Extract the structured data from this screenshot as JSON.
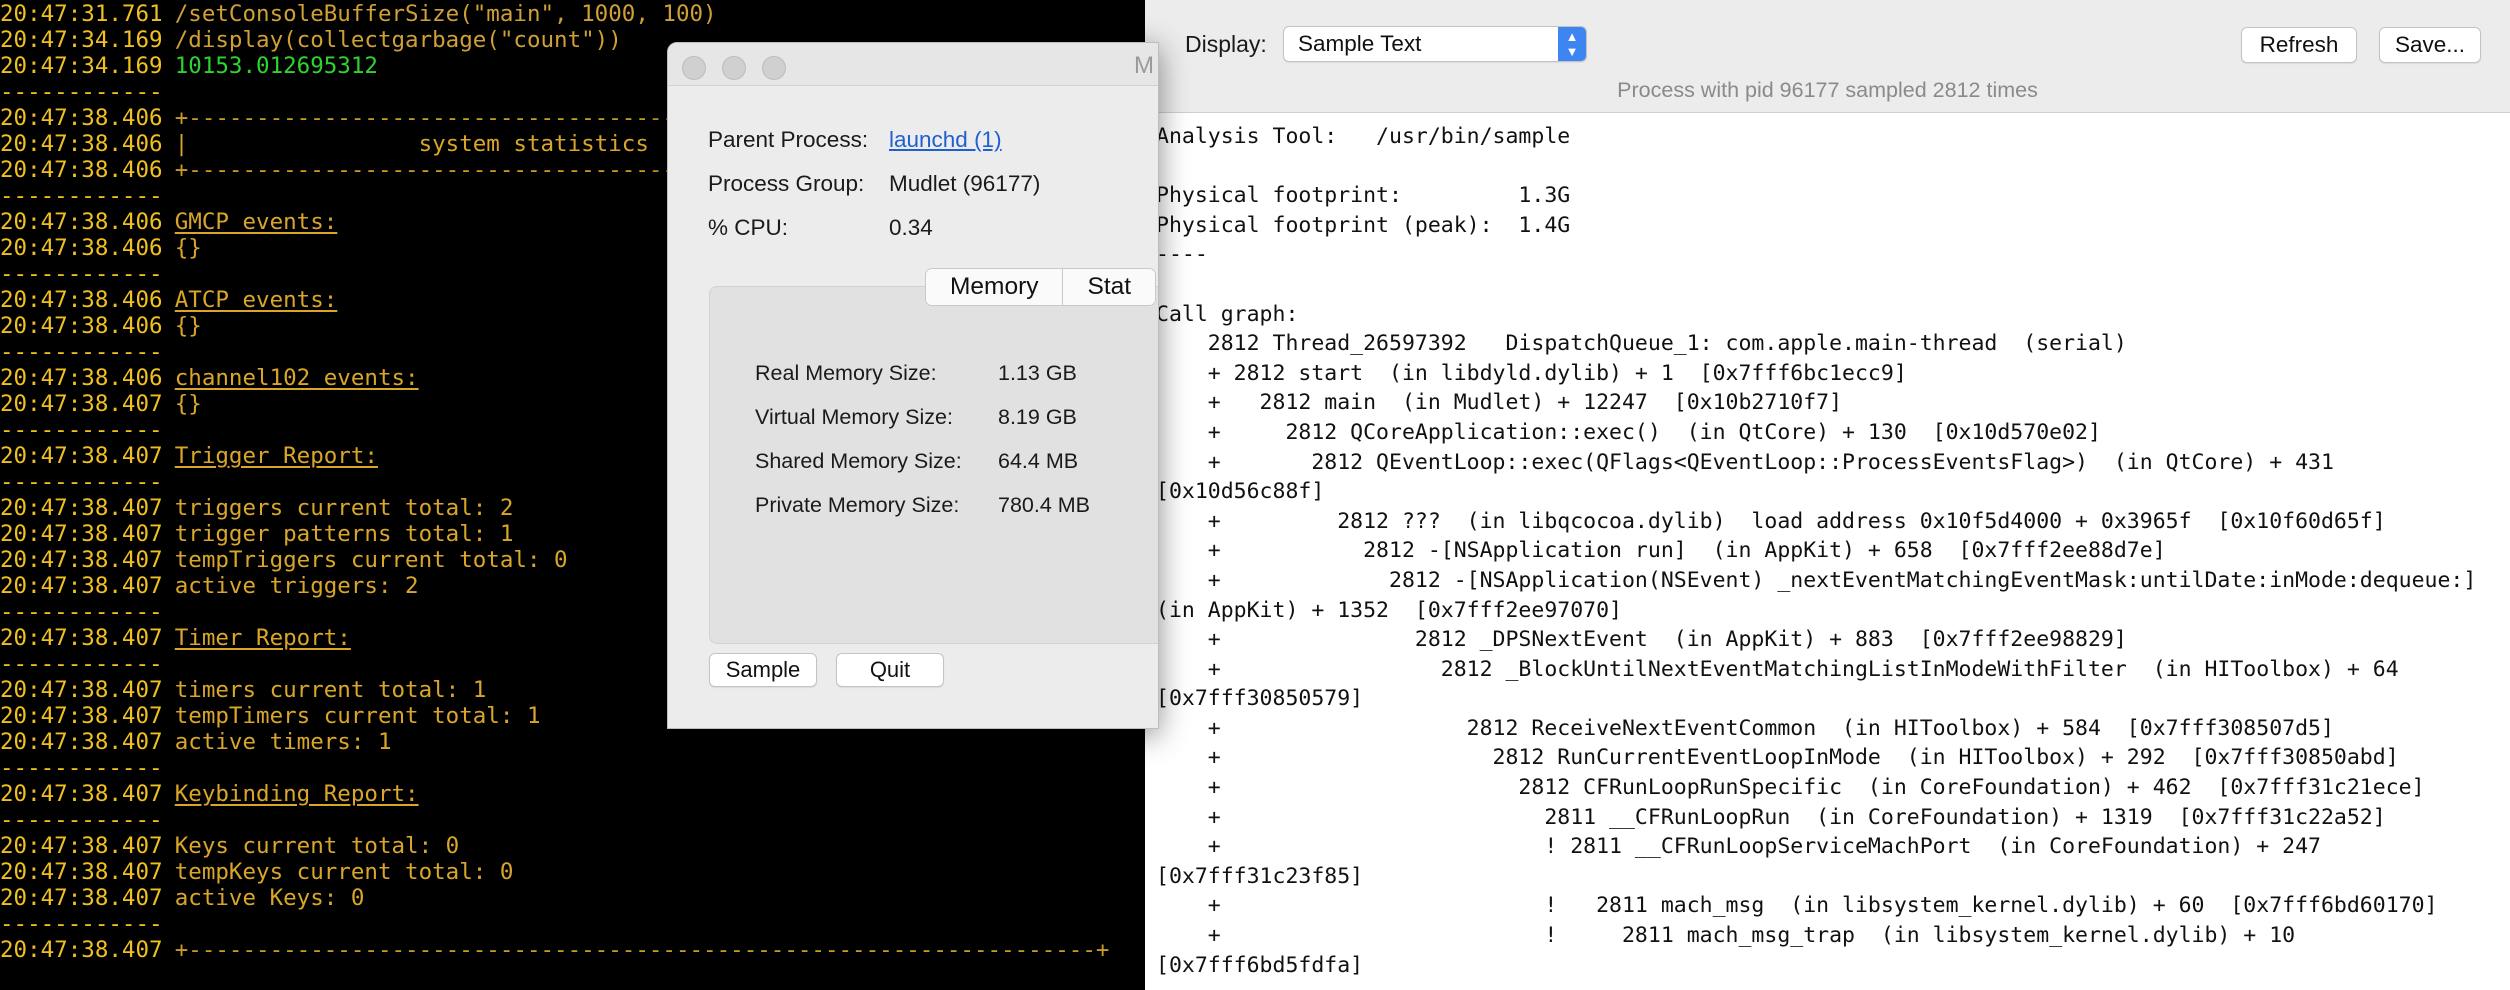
{
  "terminal": {
    "lines": [
      {
        "ts": "20:47:31.761",
        "text": "/setConsoleBufferSize(\"main\", 1000, 100)",
        "style": "cmd"
      },
      {
        "ts": "20:47:34.169",
        "text": "/display(collectgarbage(\"count\"))",
        "style": "cmd"
      },
      {
        "ts": "20:47:34.169",
        "text": "10153.012695312",
        "style": "green"
      },
      {
        "ts": "------------",
        "text": "",
        "style": "plain"
      },
      {
        "ts": "20:47:38.406",
        "text": "+-------------------------------------------------------------------+",
        "style": "sep"
      },
      {
        "ts": "20:47:38.406",
        "text": "|                 system statistics",
        "style": "plain"
      },
      {
        "ts": "20:47:38.406",
        "text": "+-------------------------------------------------------------------+",
        "style": "sep"
      },
      {
        "ts": "------------",
        "text": "",
        "style": "plain"
      },
      {
        "ts": "20:47:38.406",
        "text": "GMCP events:",
        "style": "ul"
      },
      {
        "ts": "20:47:38.406",
        "text": "{}",
        "style": "plain"
      },
      {
        "ts": "------------",
        "text": "",
        "style": "plain"
      },
      {
        "ts": "20:47:38.406",
        "text": "ATCP events:",
        "style": "ul"
      },
      {
        "ts": "20:47:38.406",
        "text": "{}",
        "style": "plain"
      },
      {
        "ts": "------------",
        "text": "",
        "style": "plain"
      },
      {
        "ts": "20:47:38.406",
        "text": "channel102 events:",
        "style": "ul"
      },
      {
        "ts": "20:47:38.407",
        "text": "{}",
        "style": "plain"
      },
      {
        "ts": "------------",
        "text": "",
        "style": "plain"
      },
      {
        "ts": "20:47:38.407",
        "text": "Trigger Report:",
        "style": "ul"
      },
      {
        "ts": "------------",
        "text": "",
        "style": "plain"
      },
      {
        "ts": "20:47:38.407",
        "text": "triggers current total: 2",
        "style": "plain"
      },
      {
        "ts": "20:47:38.407",
        "text": "trigger patterns total: 1",
        "style": "plain"
      },
      {
        "ts": "20:47:38.407",
        "text": "tempTriggers current total: 0",
        "style": "plain"
      },
      {
        "ts": "20:47:38.407",
        "text": "active triggers: 2",
        "style": "plain"
      },
      {
        "ts": "------------",
        "text": "",
        "style": "plain"
      },
      {
        "ts": "20:47:38.407",
        "text": "Timer Report:",
        "style": "ul"
      },
      {
        "ts": "------------",
        "text": "",
        "style": "plain"
      },
      {
        "ts": "20:47:38.407",
        "text": "timers current total: 1",
        "style": "plain"
      },
      {
        "ts": "20:47:38.407",
        "text": "tempTimers current total: 1",
        "style": "plain"
      },
      {
        "ts": "20:47:38.407",
        "text": "active timers: 1",
        "style": "plain"
      },
      {
        "ts": "------------",
        "text": "",
        "style": "plain"
      },
      {
        "ts": "20:47:38.407",
        "text": "Keybinding Report:",
        "style": "ul"
      },
      {
        "ts": "------------",
        "text": "",
        "style": "plain"
      },
      {
        "ts": "20:47:38.407",
        "text": "Keys current total: 0",
        "style": "plain"
      },
      {
        "ts": "20:47:38.407",
        "text": "tempKeys current total: 0",
        "style": "plain"
      },
      {
        "ts": "20:47:38.407",
        "text": "active Keys: 0",
        "style": "plain"
      },
      {
        "ts": "------------",
        "text": "",
        "style": "plain"
      },
      {
        "ts": "20:47:38.407",
        "text": "+-------------------------------------------------------------------+",
        "style": "sep"
      }
    ]
  },
  "process_window": {
    "title": "M",
    "parent_label": "Parent Process:",
    "parent_value": "launchd (1)",
    "group_label": "Process Group:",
    "group_value": "Mudlet (96177)",
    "cpu_label": "% CPU:",
    "cpu_value": "0.34",
    "tabs": [
      "Memory",
      "Stat"
    ],
    "memory": [
      {
        "label": "Real Memory Size:",
        "value": "1.13 GB"
      },
      {
        "label": "Virtual Memory Size:",
        "value": "8.19 GB"
      },
      {
        "label": "Shared Memory Size:",
        "value": "64.4 MB"
      },
      {
        "label": "Private Memory Size:",
        "value": "780.4 MB"
      }
    ],
    "sample_button": "Sample",
    "quit_button": "Quit"
  },
  "sample_window": {
    "display_label": "Display:",
    "display_value": "Sample Text",
    "refresh_button": "Refresh",
    "save_button": "Save...",
    "status": "Process with pid 96177 sampled 2812 times",
    "lines": [
      "Analysis Tool:   /usr/bin/sample",
      "",
      "Physical footprint:         1.3G",
      "Physical footprint (peak):  1.4G",
      "----",
      "",
      "Call graph:",
      "    2812 Thread_26597392   DispatchQueue_1: com.apple.main-thread  (serial)",
      "    + 2812 start  (in libdyld.dylib) + 1  [0x7fff6bc1ecc9]",
      "    +   2812 main  (in Mudlet) + 12247  [0x10b2710f7]",
      "    +     2812 QCoreApplication::exec()  (in QtCore) + 130  [0x10d570e02]",
      "    +       2812 QEventLoop::exec(QFlags<QEventLoop::ProcessEventsFlag>)  (in QtCore) + 431",
      "[0x10d56c88f]",
      "    +         2812 ???  (in libqcocoa.dylib)  load address 0x10f5d4000 + 0x3965f  [0x10f60d65f]",
      "    +           2812 -[NSApplication run]  (in AppKit) + 658  [0x7fff2ee88d7e]",
      "    +             2812 -[NSApplication(NSEvent) _nextEventMatchingEventMask:untilDate:inMode:dequeue:]",
      "(in AppKit) + 1352  [0x7fff2ee97070]",
      "    +               2812 _DPSNextEvent  (in AppKit) + 883  [0x7fff2ee98829]",
      "    +                 2812 _BlockUntilNextEventMatchingListInModeWithFilter  (in HIToolbox) + 64",
      "[0x7fff30850579]",
      "    +                   2812 ReceiveNextEventCommon  (in HIToolbox) + 584  [0x7fff308507d5]",
      "    +                     2812 RunCurrentEventLoopInMode  (in HIToolbox) + 292  [0x7fff30850abd]",
      "    +                       2812 CFRunLoopRunSpecific  (in CoreFoundation) + 462  [0x7fff31c21ece]",
      "    +                         2811 __CFRunLoopRun  (in CoreFoundation) + 1319  [0x7fff31c22a52]",
      "    +                         ! 2811 __CFRunLoopServiceMachPort  (in CoreFoundation) + 247",
      "[0x7fff31c23f85]",
      "    +                         !   2811 mach_msg  (in libsystem_kernel.dylib) + 60  [0x7fff6bd60170]",
      "    +                         !     2811 mach_msg_trap  (in libsystem_kernel.dylib) + 10",
      "[0x7fff6bd5fdfa]"
    ]
  }
}
